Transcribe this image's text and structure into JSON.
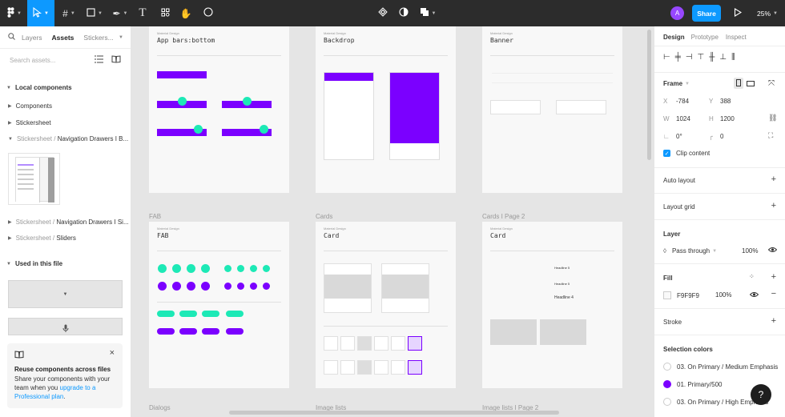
{
  "toolbar": {
    "avatar_letter": "A",
    "share_label": "Share",
    "zoom_label": "25%"
  },
  "left_panel": {
    "tabs": [
      "Layers",
      "Assets",
      "Stickers..."
    ],
    "search_placeholder": "Search assets...",
    "local_components_title": "Local components",
    "items": [
      "Components",
      "Stickersheet"
    ],
    "nav_path_prefix": "Stickersheet",
    "nav_path_1": "Navigation Drawers I B...",
    "nav_path_2": "Navigation Drawers I Si...",
    "nav_path_3": "Sliders",
    "path_sep": "/",
    "used_title": "Used in this file",
    "promo_title": "Reuse components across files",
    "promo_body": "Share your components with your team when you",
    "promo_link": "upgrade to a Professional plan",
    "promo_end": "."
  },
  "right_panel": {
    "tabs": [
      "Design",
      "Prototype",
      "Inspect"
    ],
    "frame_label": "Frame",
    "x_label": "X",
    "x_value": "-784",
    "y_label": "Y",
    "y_value": "388",
    "w_label": "W",
    "w_value": "1024",
    "h_label": "H",
    "h_value": "1200",
    "rotation": "0°",
    "radius": "0",
    "clip_label": "Clip content",
    "auto_layout": "Auto layout",
    "layout_grid": "Layout grid",
    "layer_title": "Layer",
    "pass_through": "Pass through",
    "layer_opacity": "100%",
    "fill_title": "Fill",
    "fill_hex": "F9F9F9",
    "fill_opacity": "100%",
    "stroke_title": "Stroke",
    "selection_colors_title": "Selection colors",
    "selection_colors": [
      {
        "name": "03. On Primary / Medium Emphasis",
        "color": "#ffffff"
      },
      {
        "name": "01. Primary/500",
        "color": "#7b00ff"
      },
      {
        "name": "03. On Primary / High Emphasis",
        "color": "#ffffff"
      }
    ]
  },
  "canvas": {
    "labels": {
      "fab": "FAB",
      "cards": "Cards",
      "cards2": "Cards I Page 2",
      "dialogs": "Dialogs",
      "image_lists": "Image lists",
      "image_lists2": "Image lists I Page 2"
    },
    "frames": {
      "appbars": {
        "tag": "Material Design",
        "title": "App bars:bottom"
      },
      "backdrop": {
        "tag": "Material Design",
        "title": "Backdrop"
      },
      "banner": {
        "tag": "Material Design",
        "title": "Banner"
      },
      "fab": {
        "tag": "Material Design",
        "title": "FAB"
      },
      "card": {
        "tag": "Material Design",
        "title": "Card"
      },
      "card2": {
        "tag": "Material Design",
        "title": "Card"
      }
    },
    "headline_labels": [
      "Headline 5",
      "Headline 5",
      "Headline 4"
    ]
  },
  "colors": {
    "accent": "#0d99ff",
    "primary": "#7b00ff",
    "secondary": "#1de9b6",
    "topbar": "#2c2c2c"
  }
}
